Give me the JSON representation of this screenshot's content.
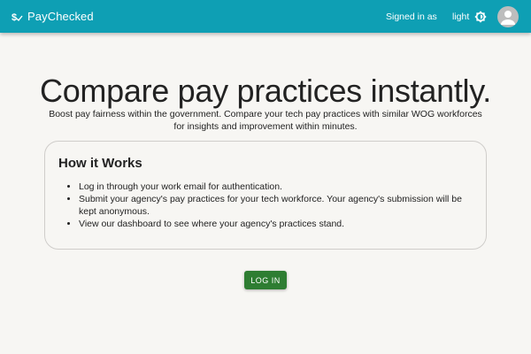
{
  "header": {
    "brand_icon": "pay-logo-icon",
    "brand_name": "PayChecked",
    "signed_in_label": "Signed in as",
    "theme_label": "light",
    "theme_icon": "brightness-icon",
    "avatar_icon": "person-icon",
    "bar_color": "#0e9fb4"
  },
  "hero": {
    "title": "Compare pay practices instantly.",
    "subtitle": "Boost pay fairness within the government. Compare your tech pay practices with similar WOG workforces for insights and improvement within minutes."
  },
  "how_it_works": {
    "title": "How it Works",
    "steps": [
      "Log in through your work email for authentication.",
      "Submit your agency's pay practices for your tech workforce. Your agency's submission will be kept anonymous.",
      "View our dashboard to see where your agency's practices stand."
    ]
  },
  "actions": {
    "login_label": "LOG IN",
    "login_color": "#2e7d32"
  }
}
